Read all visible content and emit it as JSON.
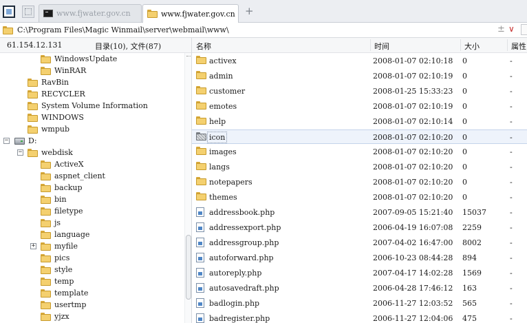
{
  "tabs": [
    {
      "label": "www.fjwater.gov.cn",
      "icon": "terminal-icon",
      "active": false
    },
    {
      "label": "www.fjwater.gov.cn",
      "icon": "folder-icon",
      "active": true
    }
  ],
  "new_tab_label": "+",
  "address": {
    "path": "C:\\Program Files\\Magic Winmail\\server\\webmail\\www\\",
    "add_symbol": "±",
    "dropdown_symbol": "∨"
  },
  "left_panel": {
    "ip": "61.154.12.131",
    "summary": "目录(10), 文件(87)",
    "tree": [
      {
        "label": "WindowsUpdate",
        "icon": "folder-icon"
      },
      {
        "label": "WinRAR",
        "icon": "folder-icon"
      },
      {
        "label": "RavBin",
        "icon": "folder-icon"
      },
      {
        "label": "RECYCLER",
        "icon": "folder-icon"
      },
      {
        "label": "System Volume Information",
        "icon": "folder-icon"
      },
      {
        "label": "WINDOWS",
        "icon": "folder-icon"
      },
      {
        "label": "wmpub",
        "icon": "folder-icon"
      },
      {
        "label": "D:",
        "icon": "drive-icon",
        "expander": "−"
      },
      {
        "label": "webdisk",
        "icon": "folder-icon",
        "expander": "−"
      },
      {
        "label": "ActiveX",
        "icon": "folder-icon"
      },
      {
        "label": "aspnet_client",
        "icon": "folder-icon"
      },
      {
        "label": "backup",
        "icon": "folder-icon"
      },
      {
        "label": "bin",
        "icon": "folder-icon"
      },
      {
        "label": "filetype",
        "icon": "folder-icon"
      },
      {
        "label": "js",
        "icon": "folder-icon"
      },
      {
        "label": "language",
        "icon": "folder-icon"
      },
      {
        "label": "myfile",
        "icon": "folder-icon",
        "expander": "+"
      },
      {
        "label": "pics",
        "icon": "folder-icon"
      },
      {
        "label": "style",
        "icon": "folder-icon"
      },
      {
        "label": "temp",
        "icon": "folder-icon"
      },
      {
        "label": "template",
        "icon": "folder-icon"
      },
      {
        "label": "usertmp",
        "icon": "folder-icon"
      },
      {
        "label": "yjzx",
        "icon": "folder-icon"
      }
    ]
  },
  "file_list": {
    "columns": {
      "name": "名称",
      "time": "时间",
      "size": "大小",
      "attr": "属性"
    },
    "rows": [
      {
        "name": "activex",
        "time": "2008-01-07 02:10:18",
        "size": "0",
        "attr": "-",
        "type": "folder"
      },
      {
        "name": "admin",
        "time": "2008-01-07 02:10:19",
        "size": "0",
        "attr": "-",
        "type": "folder"
      },
      {
        "name": "customer",
        "time": "2008-01-25 15:33:23",
        "size": "0",
        "attr": "-",
        "type": "folder"
      },
      {
        "name": "emotes",
        "time": "2008-01-07 02:10:19",
        "size": "0",
        "attr": "-",
        "type": "folder"
      },
      {
        "name": "help",
        "time": "2008-01-07 02:10:14",
        "size": "0",
        "attr": "-",
        "type": "folder"
      },
      {
        "name": "icon",
        "time": "2008-01-07 02:10:20",
        "size": "0",
        "attr": "-",
        "type": "folder-hidden",
        "selected": true
      },
      {
        "name": "images",
        "time": "2008-01-07 02:10:20",
        "size": "0",
        "attr": "-",
        "type": "folder"
      },
      {
        "name": "langs",
        "time": "2008-01-07 02:10:20",
        "size": "0",
        "attr": "-",
        "type": "folder"
      },
      {
        "name": "notepapers",
        "time": "2008-01-07 02:10:20",
        "size": "0",
        "attr": "-",
        "type": "folder"
      },
      {
        "name": "themes",
        "time": "2008-01-07 02:10:20",
        "size": "0",
        "attr": "-",
        "type": "folder"
      },
      {
        "name": "addressbook.php",
        "time": "2007-09-05 15:21:40",
        "size": "15037",
        "attr": "-",
        "type": "php"
      },
      {
        "name": "addressexport.php",
        "time": "2006-04-19 16:07:08",
        "size": "2259",
        "attr": "-",
        "type": "php"
      },
      {
        "name": "addressgroup.php",
        "time": "2007-04-02 16:47:00",
        "size": "8002",
        "attr": "-",
        "type": "php"
      },
      {
        "name": "autoforward.php",
        "time": "2006-10-23 08:44:28",
        "size": "894",
        "attr": "-",
        "type": "php"
      },
      {
        "name": "autoreply.php",
        "time": "2007-04-17 14:02:28",
        "size": "1569",
        "attr": "-",
        "type": "php"
      },
      {
        "name": "autosavedraft.php",
        "time": "2006-04-28 17:46:12",
        "size": "163",
        "attr": "-",
        "type": "php"
      },
      {
        "name": "badlogin.php",
        "time": "2006-11-27 12:03:52",
        "size": "565",
        "attr": "-",
        "type": "php"
      },
      {
        "name": "badregister.php",
        "time": "2006-11-27 12:04:06",
        "size": "475",
        "attr": "-",
        "type": "php"
      }
    ]
  }
}
